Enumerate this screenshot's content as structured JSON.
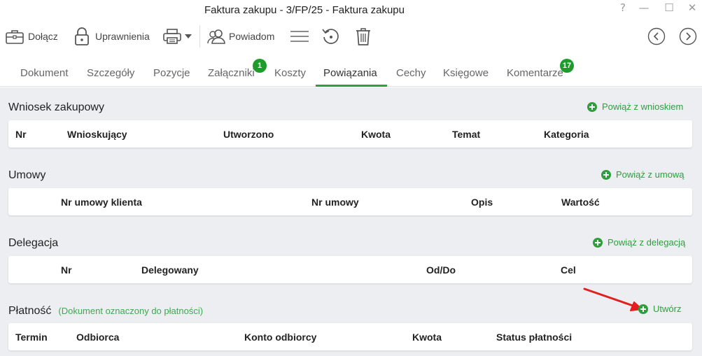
{
  "window": {
    "title": "Faktura zakupu - 3/FP/25 - Faktura zakupu",
    "help": "?",
    "minimize": "—",
    "maximize": "☐",
    "close": "✕"
  },
  "toolbar": {
    "attach_label": "Dołącz",
    "permissions_label": "Uprawnienia",
    "notify_label": "Powiadom"
  },
  "tabs": [
    {
      "label": "Dokument"
    },
    {
      "label": "Szczegóły"
    },
    {
      "label": "Pozycje"
    },
    {
      "label": "Załączniki",
      "badge": "1"
    },
    {
      "label": "Koszty"
    },
    {
      "label": "Powiązania",
      "active": true
    },
    {
      "label": "Cechy"
    },
    {
      "label": "Księgowe"
    },
    {
      "label": "Komentarze",
      "badge": "17"
    }
  ],
  "sections": {
    "wniosek": {
      "title": "Wniosek zakupowy",
      "action": "Powiąż z wnioskiem",
      "columns": [
        "Nr",
        "Wnioskujący",
        "Utworzono",
        "Kwota",
        "Temat",
        "Kategoria"
      ]
    },
    "umowy": {
      "title": "Umowy",
      "action": "Powiąż z umową",
      "columns": [
        "Nr umowy klienta",
        "Nr umowy",
        "Opis",
        "Wartość"
      ]
    },
    "delegacja": {
      "title": "Delegacja",
      "action": "Powiąż z delegacją",
      "columns": [
        "Nr",
        "Delegowany",
        "Od/Do",
        "Cel"
      ]
    },
    "platnosc": {
      "title": "Płatność",
      "note": "(Dokument oznaczony do płatności)",
      "action": "Utwórz",
      "columns": [
        "Termin",
        "Odbiorca",
        "Konto odbiorcy",
        "Kwota",
        "Status płatności"
      ]
    }
  },
  "colors": {
    "accent": "#2e9e3e",
    "badge": "#1d9c2c",
    "background": "#eceef1",
    "annotation_arrow": "#e02020"
  }
}
